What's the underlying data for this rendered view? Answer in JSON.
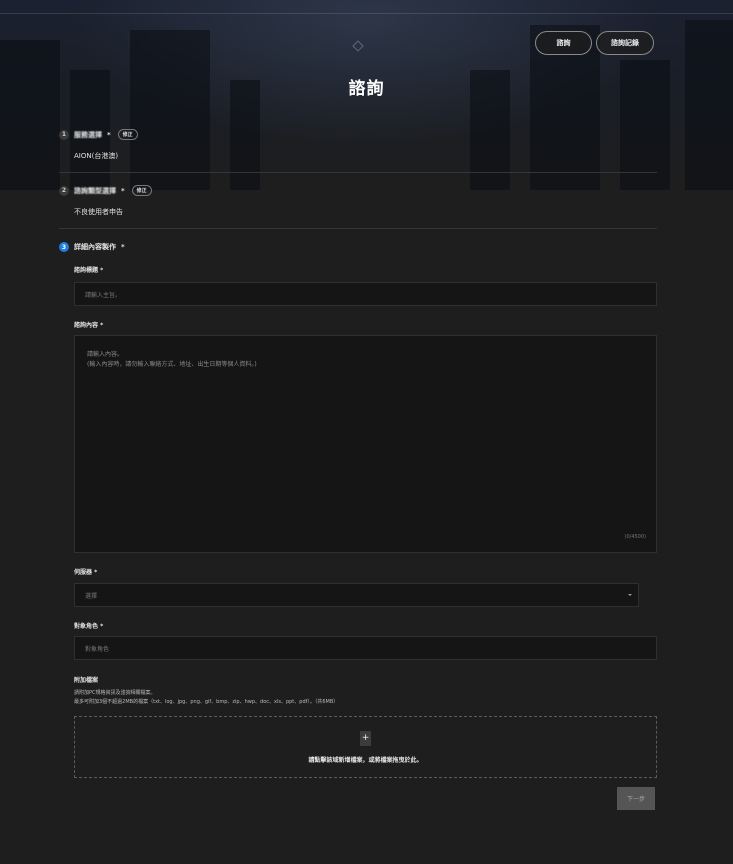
{
  "header": {
    "title": "諮詢",
    "buttons": {
      "inquiry": "諮詢",
      "history": "諮詢記錄"
    }
  },
  "steps": [
    {
      "number": "1",
      "label": "服務選擇",
      "required": "*",
      "edit": "修正",
      "value": "AION(台港澳)"
    },
    {
      "number": "2",
      "label": "諮詢類型選擇",
      "required": "*",
      "edit": "修正",
      "value": "不良使用者申告"
    },
    {
      "number": "3",
      "label": "詳細內容製作",
      "required": "*"
    }
  ],
  "form": {
    "subject": {
      "label": "諮詢標題",
      "required": "*",
      "placeholder": "請輸入主旨。"
    },
    "content": {
      "label": "諮詢內容",
      "required": "*",
      "placeholder_line1": "請輸入內容。",
      "placeholder_line2": "(輸入內容時，請勿輸入聯絡方式、地址、出生日期等個人資料。)",
      "counter": "(0/4500)"
    },
    "server": {
      "label": "伺服器",
      "required": "*",
      "selected": "選擇"
    },
    "character": {
      "label": "對象角色",
      "required": "*",
      "placeholder": "對象角色"
    },
    "attachment": {
      "label": "附加檔案",
      "hint1": "請附加PC規格資訊及諮詢相關檔案。",
      "hint2": "最多可附加3個不超過2MB的檔案（txt、log、jpg、png、gif、bmp、zip、hwp、doc、xls、ppt、pdf）。（共6MB）",
      "plus": "+",
      "drop_text": "請點擊該域新增檔案，或將檔案拖曳於此。"
    },
    "next": "下一步"
  },
  "colors": {
    "accent": "#1f7fe0",
    "background": "#1e1e1e",
    "input_bg": "#151515"
  },
  "icons": {
    "emblem": "diamond-emblem-icon",
    "caret": "chevron-down-icon",
    "add": "plus-icon"
  }
}
